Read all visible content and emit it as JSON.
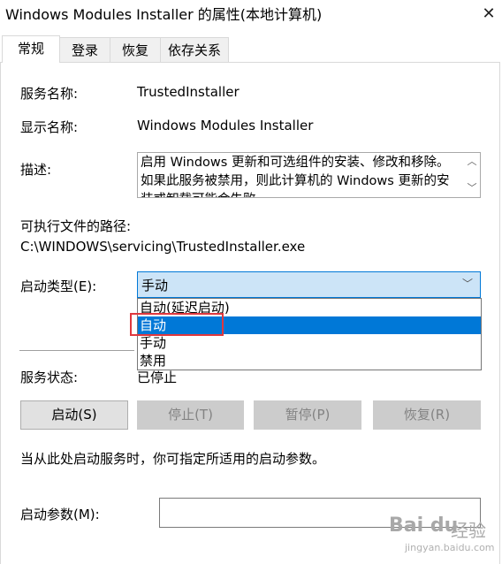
{
  "window": {
    "title": "Windows Modules Installer 的属性(本地计算机)",
    "close_glyph": "✕"
  },
  "tabs": [
    {
      "label": "常规",
      "active": true
    },
    {
      "label": "登录",
      "active": false
    },
    {
      "label": "恢复",
      "active": false
    },
    {
      "label": "依存关系",
      "active": false
    }
  ],
  "general": {
    "service_name_label": "服务名称:",
    "service_name_value": "TrustedInstaller",
    "display_name_label": "显示名称:",
    "display_name_value": "Windows Modules Installer",
    "description_label": "描述:",
    "description_value": "启用 Windows 更新和可选组件的安装、修改和移除。如果此服务被禁用，则此计算机的 Windows 更新的安装或卸载可能会失败。",
    "exe_path_label": "可执行文件的路径:",
    "exe_path_value": "C:\\WINDOWS\\servicing\\TrustedInstaller.exe",
    "startup_type_label": "启动类型(E):",
    "startup_type_value": "手动",
    "startup_options": [
      "自动(延迟启动)",
      "自动",
      "手动",
      "禁用"
    ],
    "startup_options_highlighted_index": 1,
    "service_status_label": "服务状态:",
    "service_status_value": "已停止",
    "buttons": {
      "start": "启动(S)",
      "stop": "停止(T)",
      "pause": "暂停(P)",
      "resume": "恢复(R)"
    },
    "hint_text": "当从此处启动服务时，你可指定所适用的启动参数。",
    "start_params_label": "启动参数(M):",
    "start_params_value": ""
  },
  "watermark": {
    "logo": "Bai du",
    "cn": "经验",
    "url": "jingyan.baidu.com"
  },
  "colors": {
    "selection_blue": "#0078d7",
    "combo_focus_bg": "#cce4f7",
    "annotation_red": "#e0383e"
  }
}
